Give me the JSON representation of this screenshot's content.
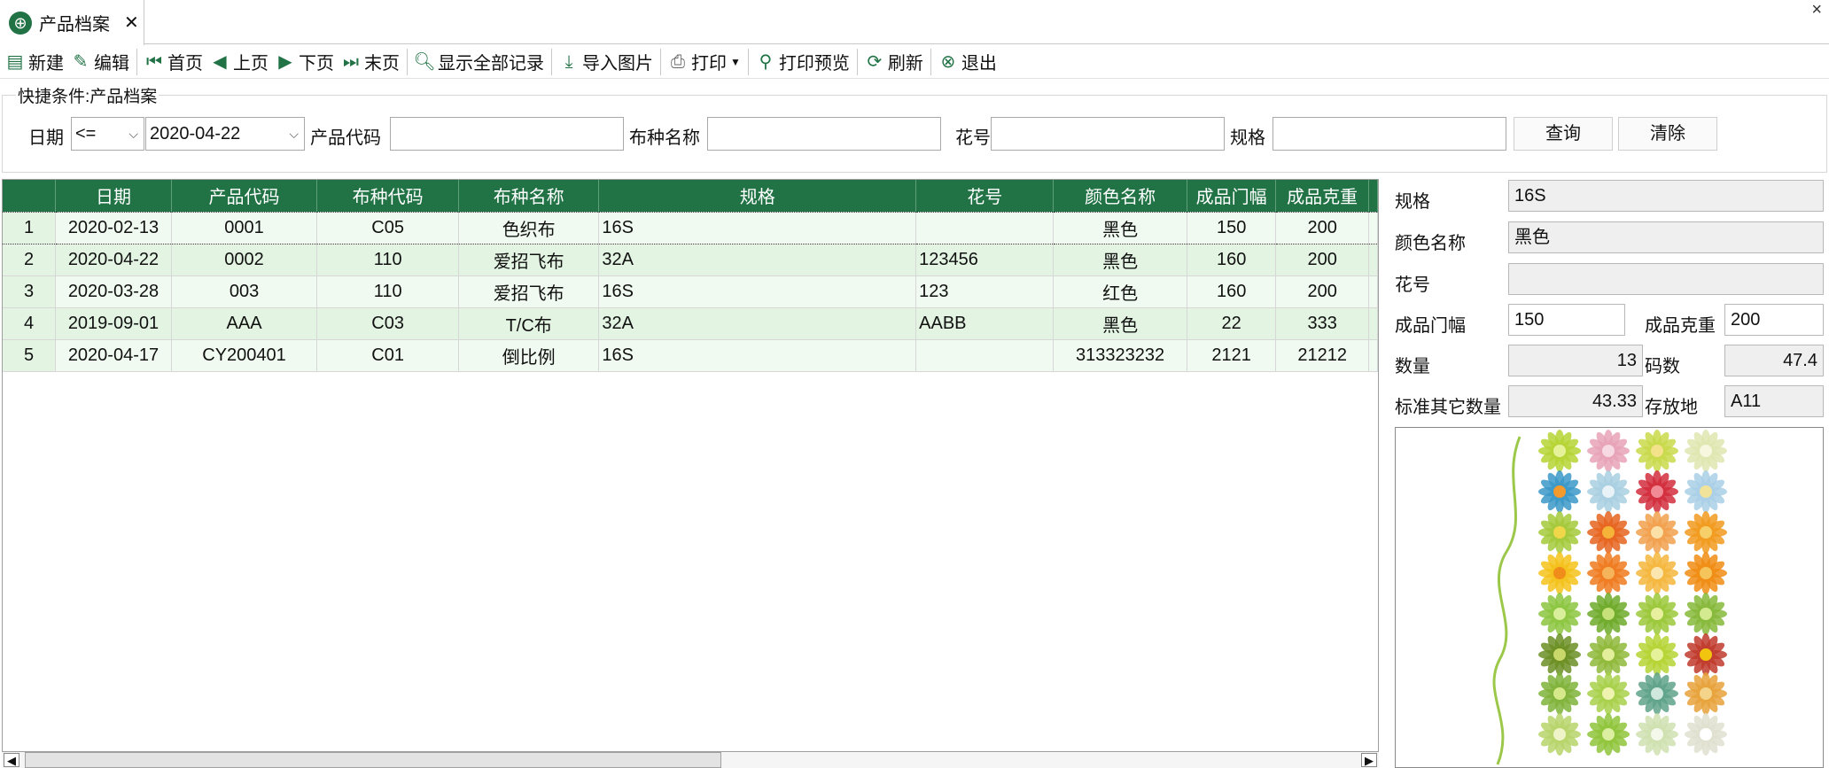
{
  "tab": {
    "title": "产品档案",
    "close": "✕"
  },
  "window": {
    "close": "×"
  },
  "toolbar": {
    "new": "新建",
    "edit": "编辑",
    "first": "首页",
    "prev": "上页",
    "next": "下页",
    "last": "末页",
    "show_all": "显示全部记录",
    "import_image": "导入图片",
    "print": "打印",
    "print_preview": "打印预览",
    "refresh": "刷新",
    "exit": "退出"
  },
  "filter": {
    "legend": "快捷条件:产品档案",
    "date_label": "日期",
    "operator": "<=",
    "date_value": "2020-04-22",
    "product_code_label": "产品代码",
    "product_code_value": "",
    "fabric_name_label": "布种名称",
    "fabric_name_value": "",
    "pattern_label": "花号",
    "pattern_value": "",
    "spec_label": "规格",
    "spec_value": "",
    "query_button": "查询",
    "clear_button": "清除"
  },
  "grid": {
    "columns": [
      "日期",
      "产品代码",
      "布种代码",
      "布种名称",
      "规格",
      "花号",
      "颜色名称",
      "成品门幅",
      "成品克重"
    ],
    "rows": [
      {
        "n": "1",
        "date": "2020-02-13",
        "code": "0001",
        "fabric_code": "C05",
        "fabric_name": "色织布",
        "spec": "16S",
        "pattern": "",
        "color": "黑色",
        "width": "150",
        "weight": "200"
      },
      {
        "n": "2",
        "date": "2020-04-22",
        "code": "0002",
        "fabric_code": "110",
        "fabric_name": "爱招飞布",
        "spec": "32A",
        "pattern": "123456",
        "color": "黑色",
        "width": "160",
        "weight": "200"
      },
      {
        "n": "3",
        "date": "2020-03-28",
        "code": "003",
        "fabric_code": "110",
        "fabric_name": "爱招飞布",
        "spec": "16S",
        "pattern": "123",
        "color": "红色",
        "width": "160",
        "weight": "200"
      },
      {
        "n": "4",
        "date": "2019-09-01",
        "code": "AAA",
        "fabric_code": "C03",
        "fabric_name": "T/C布",
        "spec": "32A",
        "pattern": "AABB",
        "color": "黑色",
        "width": "22",
        "weight": "333"
      },
      {
        "n": "5",
        "date": "2020-04-17",
        "code": "CY200401",
        "fabric_code": "C01",
        "fabric_name": "倒比例",
        "spec": "16S",
        "pattern": "",
        "color": "313323232",
        "width": "2121",
        "weight": "21212"
      }
    ]
  },
  "detail": {
    "spec_label": "规格",
    "spec_value": "16S",
    "color_label": "颜色名称",
    "color_value": "黑色",
    "pattern_label": "花号",
    "pattern_value": "",
    "width_label": "成品门幅",
    "width_value": "150",
    "weight_label": "成品克重",
    "weight_value": "200",
    "qty_label": "数量",
    "qty_value": "13",
    "yards_label": "码数",
    "yards_value": "47.4",
    "std_qty_label": "标准其它数量",
    "std_qty_value": "43.33",
    "location_label": "存放地",
    "location_value": "A11"
  },
  "colors": {
    "header_green": "#217346",
    "row_light": "#f0faf0",
    "row_dark": "#e3f4e3"
  }
}
